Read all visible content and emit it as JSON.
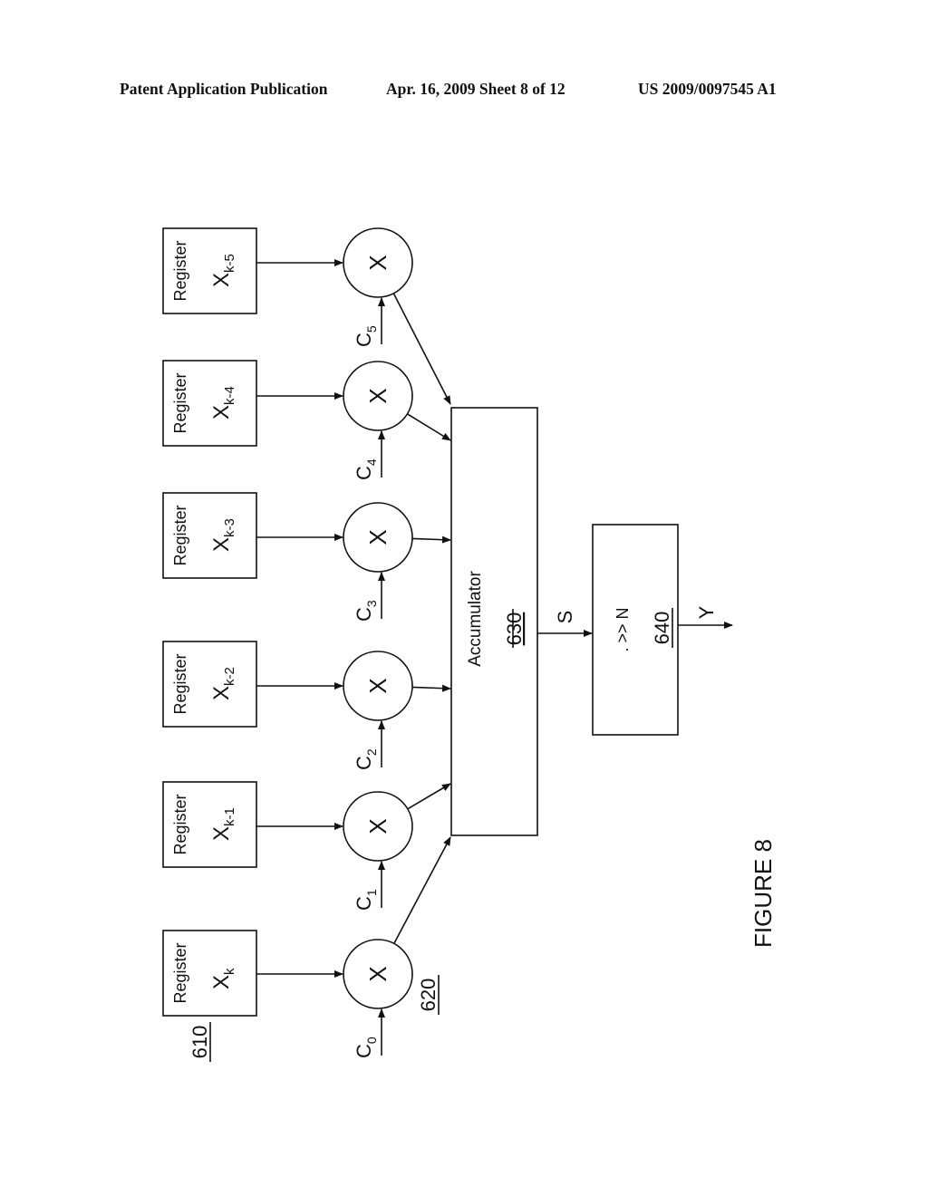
{
  "header": {
    "publication": "Patent Application Publication",
    "date_sheet": "Apr. 16, 2009  Sheet 8 of 12",
    "patent_number": "US 2009/0097545 A1"
  },
  "figure": {
    "caption": "FIGURE 8",
    "register_ref": "610",
    "multiplier_ref": "620",
    "registers": [
      {
        "label": "Register",
        "var": "X",
        "sub": "k"
      },
      {
        "label": "Register",
        "var": "X",
        "sub": "k-1"
      },
      {
        "label": "Register",
        "var": "X",
        "sub": "k-2"
      },
      {
        "label": "Register",
        "var": "X",
        "sub": "k-3"
      },
      {
        "label": "Register",
        "var": "X",
        "sub": "k-4"
      },
      {
        "label": "Register",
        "var": "X",
        "sub": "k-5"
      }
    ],
    "multipliers": [
      {
        "symbol": "X",
        "coef": "C",
        "coef_sub": "0"
      },
      {
        "symbol": "X",
        "coef": "C",
        "coef_sub": "1"
      },
      {
        "symbol": "X",
        "coef": "C",
        "coef_sub": "2"
      },
      {
        "symbol": "X",
        "coef": "C",
        "coef_sub": "3"
      },
      {
        "symbol": "X",
        "coef": "C",
        "coef_sub": "4"
      },
      {
        "symbol": "X",
        "coef": "C",
        "coef_sub": "5"
      }
    ],
    "accumulator": {
      "label": "Accumulator",
      "ref": "630"
    },
    "sum_signal": "S",
    "shifter": {
      "label": ". >> N",
      "ref": "640"
    },
    "output_signal": "Y"
  }
}
